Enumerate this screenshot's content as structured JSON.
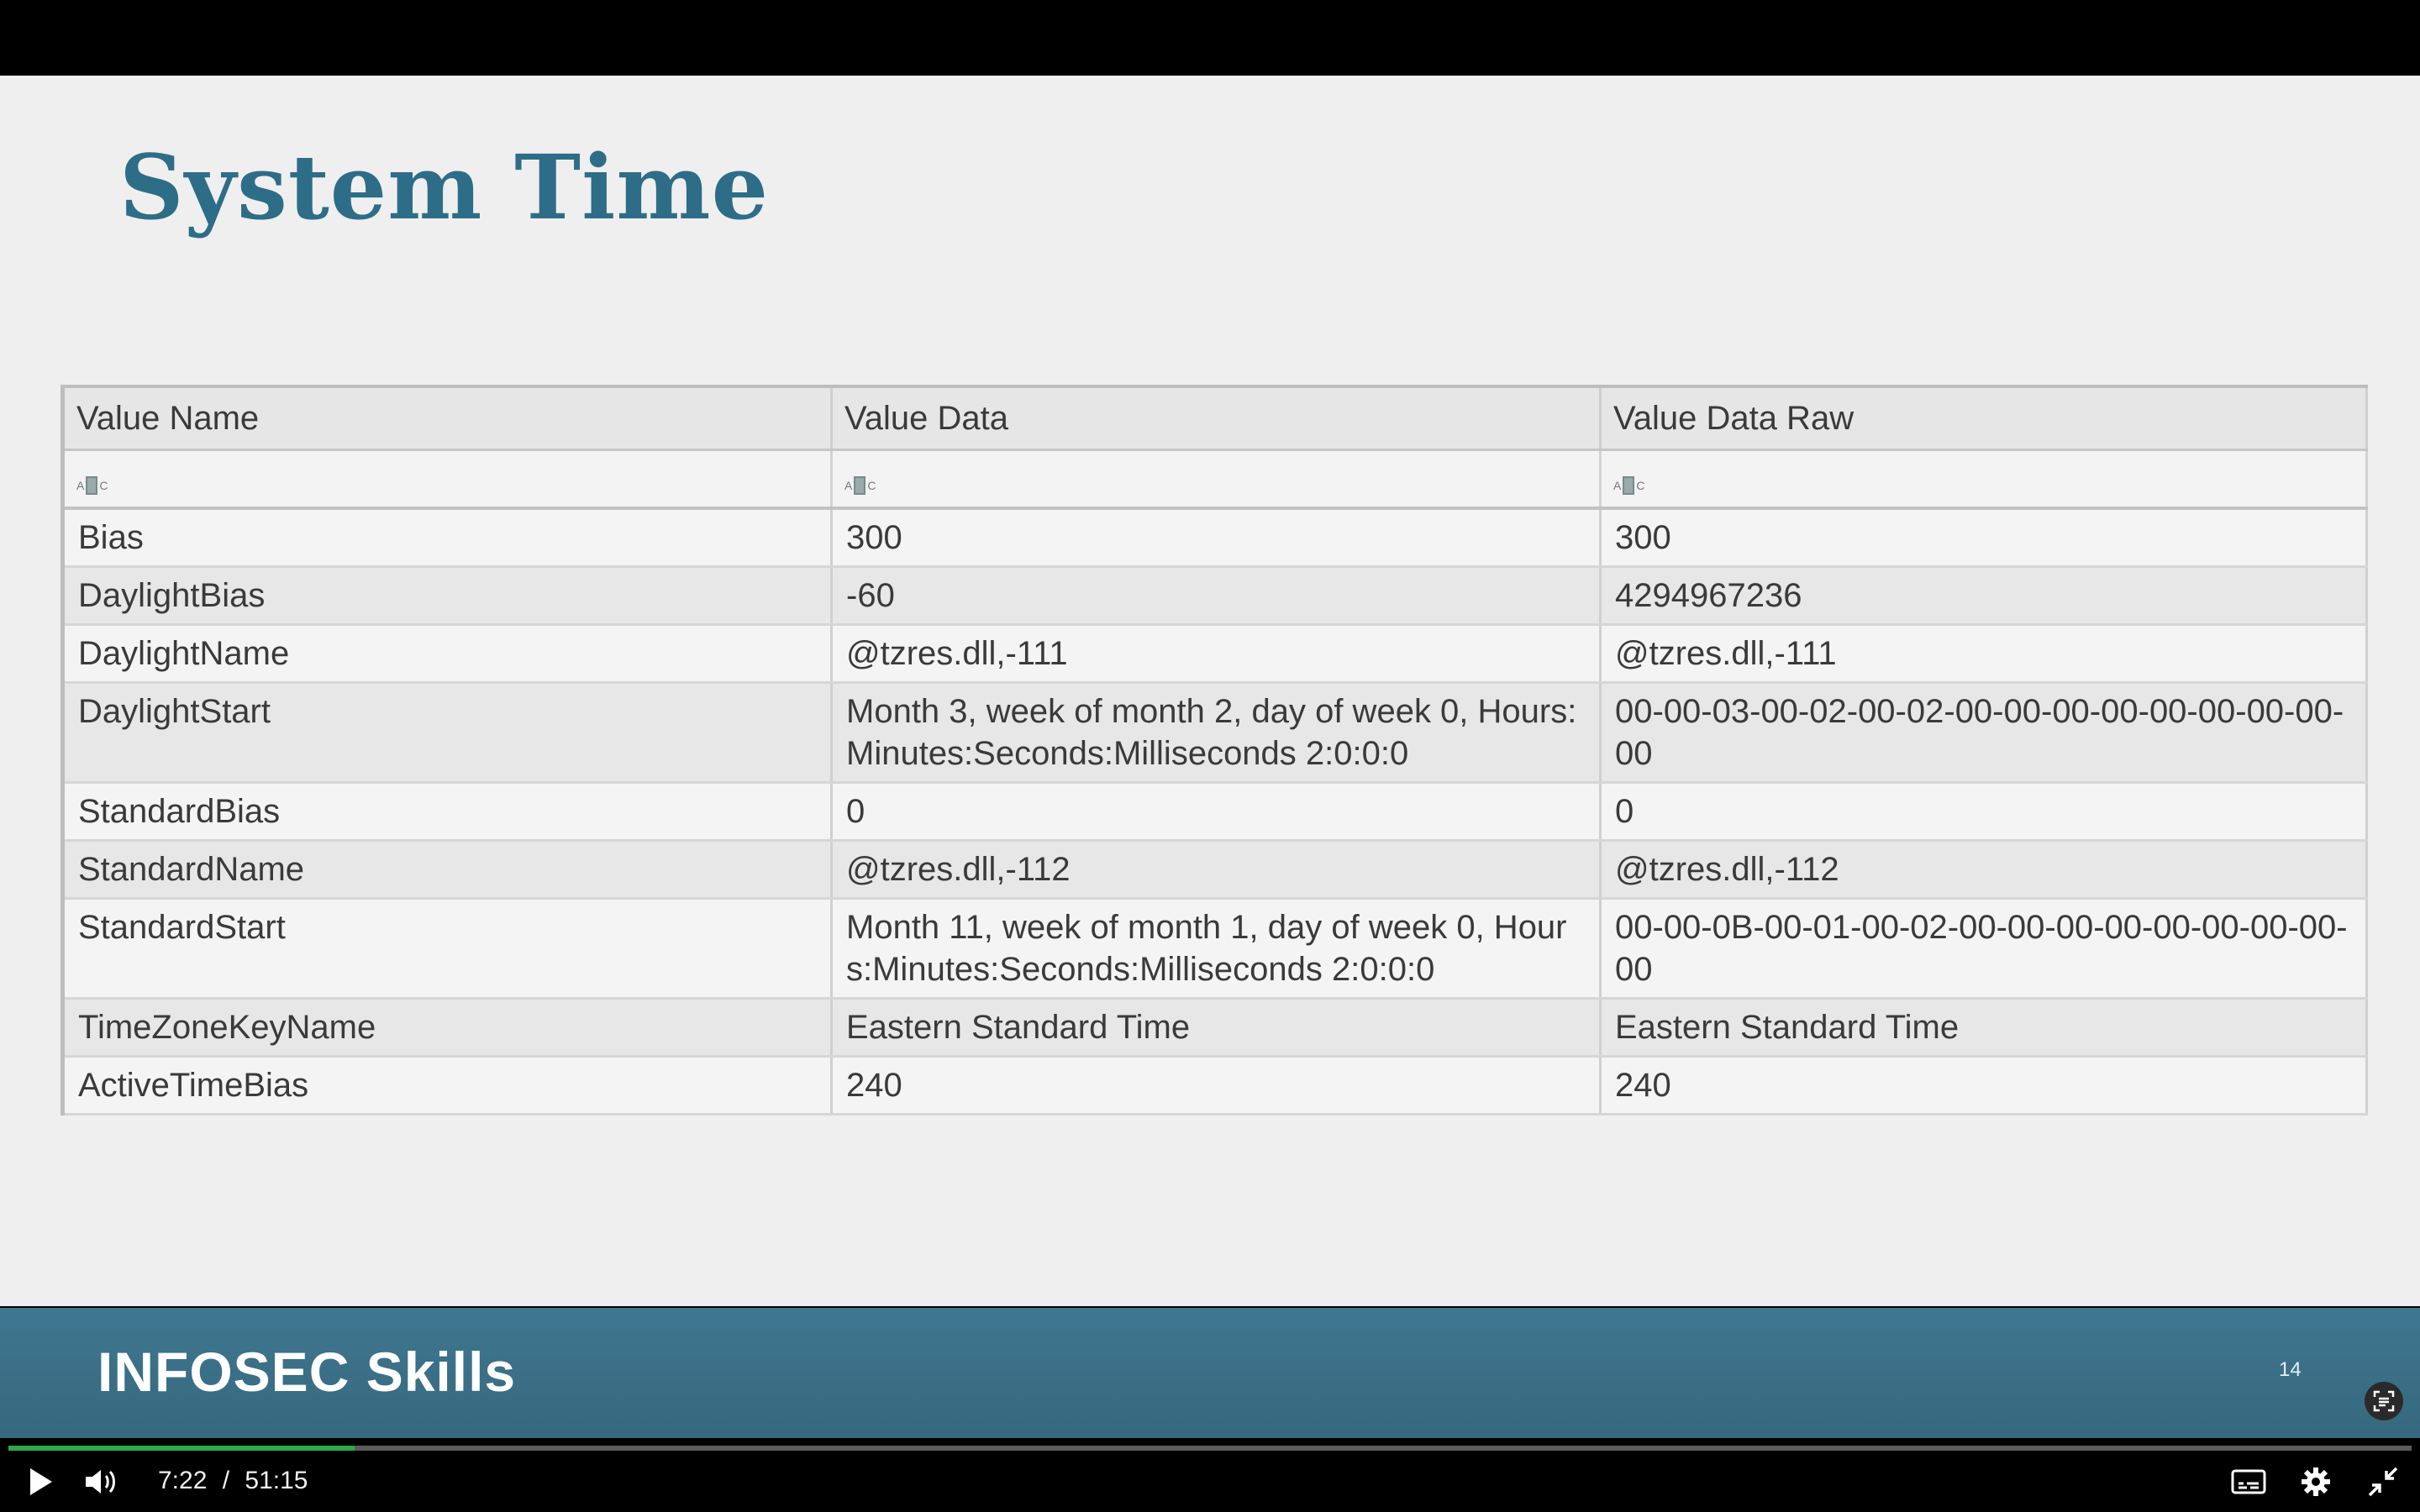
{
  "slide": {
    "title": "System Time",
    "table": {
      "headers": [
        "Value Name",
        "Value Data",
        "Value Data Raw"
      ],
      "filter_icon": "text-filter-icon",
      "rows": [
        [
          "Bias",
          "300",
          "300"
        ],
        [
          "DaylightBias",
          "-60",
          "4294967236"
        ],
        [
          "DaylightName",
          "@tzres.dll,-111",
          "@tzres.dll,-111"
        ],
        [
          "DaylightStart",
          "Month 3, week of month 2, day of week 0, Hours:Minutes:Seconds:Milliseconds 2:0:0:0",
          "00-00-03-00-02-00-02-00-00-00-00-00-00-00-00-00"
        ],
        [
          "StandardBias",
          "0",
          "0"
        ],
        [
          "StandardName",
          "@tzres.dll,-112",
          "@tzres.dll,-112"
        ],
        [
          "StandardStart",
          "Month 11, week of month 1, day of week 0, Hours:Minutes:Seconds:Milliseconds 2:0:0:0",
          "00-00-0B-00-01-00-02-00-00-00-00-00-00-00-00-00"
        ],
        [
          "TimeZoneKeyName",
          "Eastern Standard Time",
          "Eastern Standard Time"
        ],
        [
          "ActiveTimeBias",
          "240",
          "240"
        ]
      ]
    },
    "footer": {
      "logo": "INFOSEC Skills",
      "slide_number": "14"
    }
  },
  "player": {
    "current_time": "7:22",
    "separator": "/",
    "duration": "51:15",
    "progress_fraction": 0.1439,
    "accent_color": "#2ea84a",
    "icons": [
      "play-icon",
      "volume-icon",
      "captions-icon",
      "settings-icon",
      "exit-fullscreen-icon",
      "scan-text-icon"
    ]
  }
}
